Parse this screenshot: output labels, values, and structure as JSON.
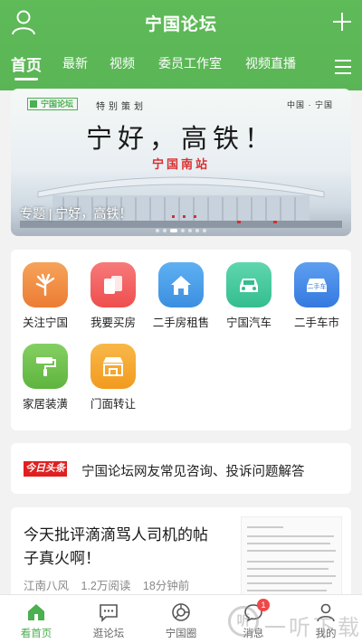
{
  "header": {
    "title": "宁国论坛",
    "tabs": [
      "首页",
      "最新",
      "视频",
      "委员工作室",
      "视频直播"
    ]
  },
  "banner": {
    "logo_text": "宁国论坛",
    "special_label": "特别策划",
    "corner_text": "中国 · 宁国",
    "headline": "宁好，高铁！",
    "station_sign": "宁国南站",
    "caption": "专题 | 宁好，高铁！",
    "page_count": 7,
    "active_page": 3
  },
  "services": [
    {
      "label": "关注宁国",
      "icon": "hand-icon",
      "color": "#f08a3c"
    },
    {
      "label": "我要买房",
      "icon": "house-card-icon",
      "color": "#f25555"
    },
    {
      "label": "二手房租售",
      "icon": "home-icon",
      "color": "#3d9be9"
    },
    {
      "label": "宁国汽车",
      "icon": "car-icon",
      "color": "#3cc49a"
    },
    {
      "label": "二手车市",
      "icon": "used-car-icon",
      "color": "#3d86e6"
    },
    {
      "label": "家居装潢",
      "icon": "paint-roller-icon",
      "color": "#6cc04a"
    },
    {
      "label": "门面转让",
      "icon": "storefront-icon",
      "color": "#f5a623"
    }
  ],
  "news_bar": {
    "logo_text": "今日头条",
    "text": "宁国论坛网友常见咨询、投诉问题解答"
  },
  "article": {
    "title": "今天批评滴滴骂人司机的帖子真火啊！",
    "author": "江南八风",
    "reads": "1.2万阅读",
    "time": "18分钟前"
  },
  "tabbar": {
    "items": [
      {
        "label": "看首页",
        "icon": "home-tab-icon"
      },
      {
        "label": "逛论坛",
        "icon": "chat-tab-icon"
      },
      {
        "label": "宁国圈",
        "icon": "circle-tab-icon"
      },
      {
        "label": "消息",
        "icon": "message-tab-icon"
      },
      {
        "label": "我的",
        "icon": "profile-tab-icon"
      }
    ],
    "message_badge": "1"
  },
  "watermark": {
    "glyph": "听",
    "text": "一听下载"
  },
  "colors": {
    "brand_green": "#5cb85c",
    "badge_red": "#f04848"
  }
}
